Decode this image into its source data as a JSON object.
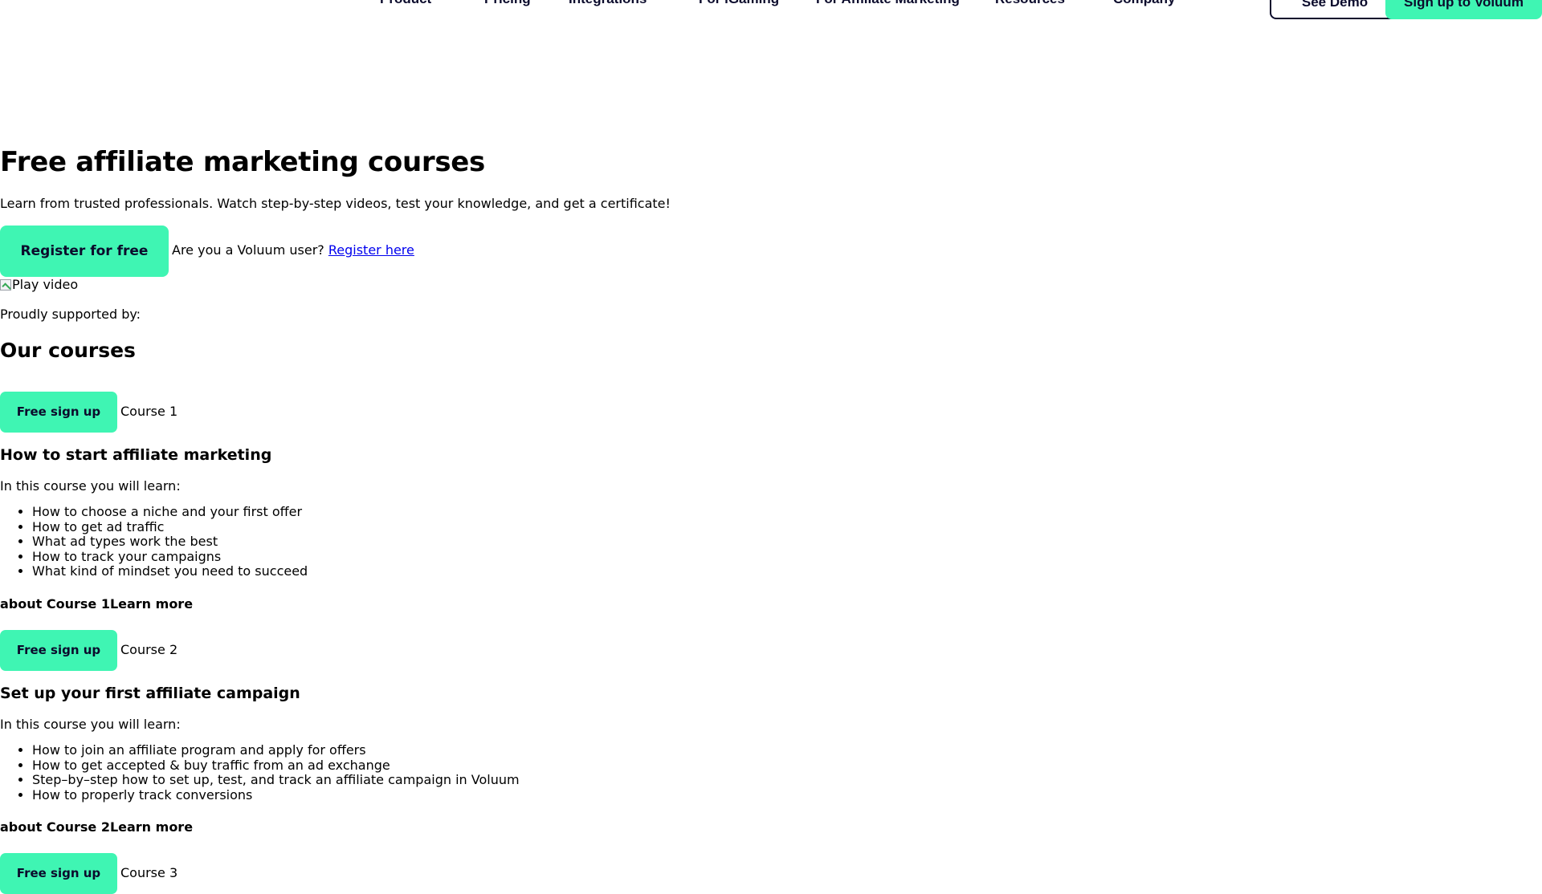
{
  "nav": {
    "items": [
      "Product",
      "Pricing",
      "Integrations",
      "For iGaming",
      "For Affiliate Marketing",
      "Resources",
      "Company"
    ],
    "demo_label": "See Demo",
    "signup_label": "Sign up to Voluum"
  },
  "hero": {
    "title": "Free affiliate marketing courses",
    "lead": "Learn from trusted professionals. Watch step-by-step videos, test your knowledge, and get a certificate!",
    "register_button": "Register for free",
    "user_prompt": "Are you a Voluum user?",
    "user_link": "Register here",
    "video_alt": "Play video",
    "supported": "Proudly supported by:"
  },
  "courses_heading": "Our courses",
  "courses": [
    {
      "button": "Free sign up",
      "number": "Course 1",
      "title": "How to start affiliate marketing",
      "intro": "In this course you will learn:",
      "items": [
        "How to choose a niche and your first offer",
        "How to get ad traffic",
        "What ad types work the best",
        "How to track your campaigns",
        "What kind of mindset you need to succeed"
      ],
      "learn_more": "about Course 1Learn more"
    },
    {
      "button": "Free sign up",
      "number": "Course 2",
      "title": "Set up your first affiliate campaign",
      "intro": "In this course you will learn:",
      "items": [
        "How to join an affiliate program and apply for offers",
        "How to get accepted & buy traffic from an ad exchange",
        "Step–by–step how to set up, test, and track an affiliate campaign in Voluum",
        "How to properly track conversions"
      ],
      "learn_more": "about Course 2Learn more"
    },
    {
      "button": "Free sign up",
      "number": "Course 3"
    }
  ],
  "colors": {
    "accent": "#3ff5b3",
    "text_dark": "#0b0b2c",
    "link": "#0000ee"
  }
}
